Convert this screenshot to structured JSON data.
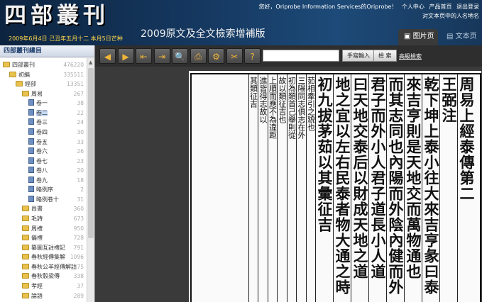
{
  "header": {
    "logo_text": "四部叢刊",
    "subtitle": "2009原文及全文檢索增補版",
    "date_line": "2009年6月4日 己丑年五月十二 本月5日芒种",
    "greeting": "您好，Oriprobe Information Services的Oriprobe！",
    "links": [
      "个人中心",
      "产品首页",
      "退出登录"
    ],
    "hint": "对文本页中的人名地名"
  },
  "view_tabs": {
    "image": "图片页",
    "text": "文本页"
  },
  "sidebar": {
    "title": "四部叢刊總目",
    "tree": [
      {
        "label": "四部叢刊",
        "count": "476220",
        "level": 0,
        "icon": "folder-icon"
      },
      {
        "label": "初編",
        "count": "335511",
        "level": 1,
        "icon": "folder-icon"
      },
      {
        "label": "經部",
        "count": "13351",
        "level": 2,
        "icon": "folder-icon"
      },
      {
        "label": "周易",
        "count": "267",
        "level": 3,
        "icon": "folder-icon"
      },
      {
        "label": "卷一",
        "count": "38",
        "level": 4,
        "icon": "document-icon"
      },
      {
        "label": "卷二",
        "count": "22",
        "level": 4,
        "icon": "document-icon",
        "selected": true
      },
      {
        "label": "卷三",
        "count": "24",
        "level": 4,
        "icon": "document-icon"
      },
      {
        "label": "卷四",
        "count": "30",
        "level": 4,
        "icon": "document-icon"
      },
      {
        "label": "卷五",
        "count": "33",
        "level": 4,
        "icon": "document-icon"
      },
      {
        "label": "卷六",
        "count": "26",
        "level": 4,
        "icon": "document-icon"
      },
      {
        "label": "卷七",
        "count": "23",
        "level": 4,
        "icon": "document-icon"
      },
      {
        "label": "卷八",
        "count": "20",
        "level": 4,
        "icon": "document-icon"
      },
      {
        "label": "卷九",
        "count": "18",
        "level": 4,
        "icon": "document-icon"
      },
      {
        "label": "略例序",
        "count": "2",
        "level": 4,
        "icon": "document-icon"
      },
      {
        "label": "略例卷十",
        "count": "31",
        "level": 4,
        "icon": "document-icon"
      },
      {
        "label": "尚書",
        "count": "360",
        "level": 3,
        "icon": "folder-icon"
      },
      {
        "label": "毛詩",
        "count": "673",
        "level": 3,
        "icon": "folder-icon"
      },
      {
        "label": "周禮",
        "count": "950",
        "level": 3,
        "icon": "folder-icon"
      },
      {
        "label": "儀禮",
        "count": "728",
        "level": 3,
        "icon": "folder-icon"
      },
      {
        "label": "纂圖互註禮記",
        "count": "791",
        "level": 3,
        "icon": "folder-icon"
      },
      {
        "label": "春秋經傳集解",
        "count": "1096",
        "level": 3,
        "icon": "folder-icon"
      },
      {
        "label": "春秋公羊經傳解詁",
        "count": "575",
        "level": 3,
        "icon": "folder-icon"
      },
      {
        "label": "春秋穀梁傳",
        "count": "338",
        "level": 3,
        "icon": "folder-icon"
      },
      {
        "label": "孝經",
        "count": "37",
        "level": 3,
        "icon": "folder-icon"
      },
      {
        "label": "論語",
        "count": "289",
        "level": 3,
        "icon": "folder-icon"
      }
    ]
  },
  "toolbar": {
    "buttons": [
      {
        "icon": "previous-arrow-icon",
        "glyph": "◀"
      },
      {
        "icon": "next-arrow-icon",
        "glyph": "▶"
      },
      {
        "icon": "first-page-icon",
        "glyph": "⇤"
      },
      {
        "icon": "last-page-icon",
        "glyph": "⇥"
      },
      {
        "icon": "zoom-icon",
        "glyph": "🔍"
      },
      {
        "icon": "print-icon",
        "glyph": "⎙"
      },
      {
        "icon": "settings-icon",
        "glyph": "⚙"
      },
      {
        "icon": "tools-icon",
        "glyph": "✂"
      },
      {
        "icon": "help-icon",
        "glyph": "?"
      }
    ],
    "handwrite_label": "手寫輸入",
    "search_label": "檢 索",
    "advanced_label": "高級檢索",
    "search_value": ""
  },
  "page": {
    "columns": [
      {
        "text": "周易上經泰傳第二",
        "style": "big"
      },
      {
        "text": "王弼注",
        "style": "big"
      },
      {
        "text": "乾下坤上泰小往大來吉亨彖曰泰",
        "style": "big"
      },
      {
        "text": "來吉亨則是天地交而萬物通也",
        "style": "big"
      },
      {
        "text": "而其志同也內陽而外陰內健而外",
        "style": "big"
      },
      {
        "text": "君子而外小人君子道長小人道",
        "style": "big"
      },
      {
        "text": "曰天地交泰后以財成天地之道",
        "style": "big"
      },
      {
        "text": "地之宜以左右民泰者物大通之時",
        "style": "big"
      },
      {
        "text": "初九拔茅茹以其彙征吉",
        "style": "big"
      },
      {
        "text": "茹相牽引之貌也",
        "style": "small"
      },
      {
        "text": "三陽同志俱志在外",
        "style": "small"
      },
      {
        "text": "初為類首己舉則從",
        "style": "small"
      },
      {
        "text": "故以類征吉也",
        "style": "small"
      },
      {
        "text": "上順而應不為違距",
        "style": "small"
      },
      {
        "text": "進皆得志故以",
        "style": "small"
      },
      {
        "text": "其類征吉",
        "style": "small"
      }
    ]
  }
}
